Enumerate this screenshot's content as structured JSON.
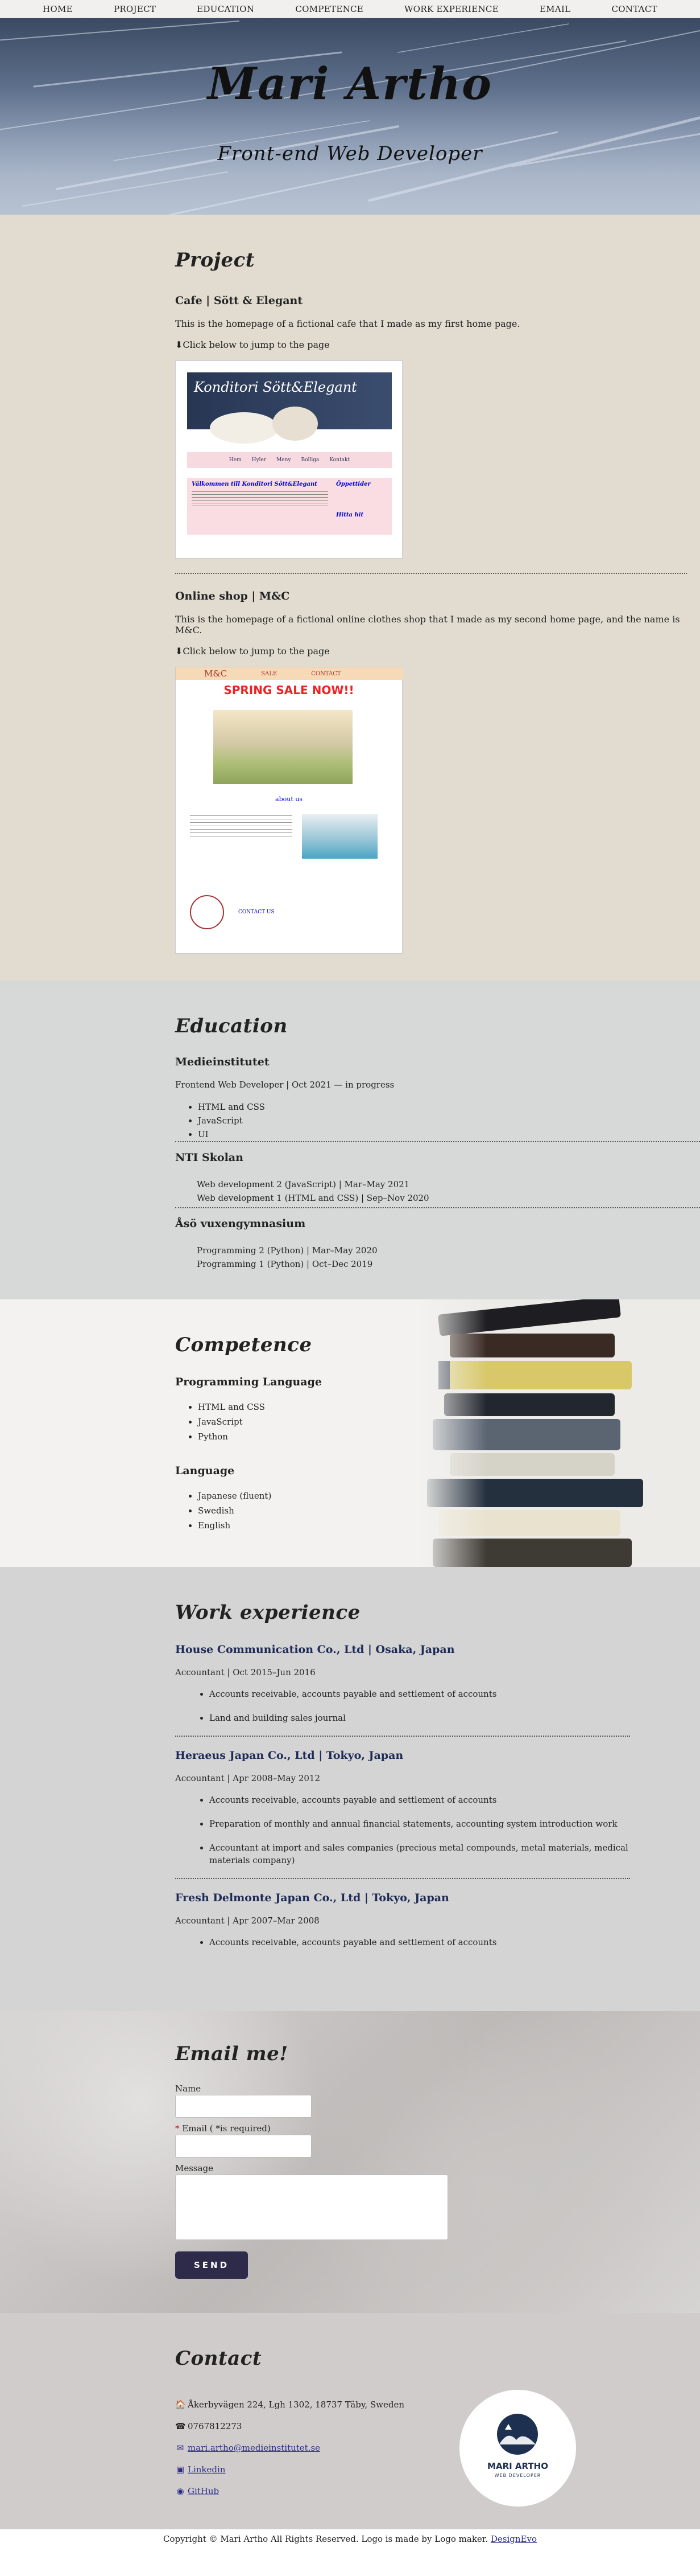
{
  "nav": [
    "HOME",
    "PROJECT",
    "EDUCATION",
    "COMPETENCE",
    "WORK EXPERIENCE",
    "EMAIL",
    "CONTACT"
  ],
  "hero": {
    "title": "Mari Artho",
    "subtitle": "Front-end Web Developer"
  },
  "project": {
    "title": "Project",
    "items": [
      {
        "name": "Cafe | Sött & Elegant",
        "desc": "This is the homepage of a fictional cafe that I made as my first home page.",
        "jump": "⬇Click below to jump to the page",
        "thumb": {
          "banner": "Konditori Sött&Elegant",
          "menu": [
            "Hem",
            "Hyler",
            "Meny",
            "Bolliga",
            "Kontakt"
          ],
          "welcome": "Välkommen till Konditori Sött&Elegant",
          "hours": "Öppettider",
          "find": "Hitta hit"
        }
      },
      {
        "name": "Online shop | M&C",
        "desc": "This is the homepage of a fictional online clothes shop that I made as my second home page, and the name is M&C.",
        "jump": "⬇Click below to jump to the page",
        "thumb": {
          "brand": "M&C",
          "links": [
            "SALE",
            "CONTACT"
          ],
          "sale": "SPRING SALE NOW!!",
          "about": "about us",
          "contact": "CONTACT US"
        }
      }
    ]
  },
  "education": {
    "title": "Education",
    "schools": [
      {
        "name": "Medieinstitutet",
        "line": "Frontend Web Developer | Oct 2021 — in progress",
        "items": [
          "HTML and CSS",
          "JavaScript",
          "UI"
        ]
      },
      {
        "name": "NTI Skolan",
        "items": [
          "Web development 2 (JavaScript) | Mar–May 2021",
          "Web development 1 (HTML and CSS) | Sep–Nov 2020"
        ]
      },
      {
        "name": "Åsö vuxengymnasium",
        "items": [
          "Programming 2 (Python) | Mar–May 2020",
          "Programming 1 (Python) | Oct–Dec 2019"
        ]
      }
    ]
  },
  "competence": {
    "title": "Competence",
    "groups": [
      {
        "name": "Programming Language",
        "items": [
          "HTML and CSS",
          "JavaScript",
          "Python"
        ]
      },
      {
        "name": "Language",
        "items": [
          "Japanese (fluent)",
          "Swedish",
          "English"
        ]
      }
    ]
  },
  "work": {
    "title": "Work experience",
    "jobs": [
      {
        "company": "House Communication Co., Ltd | Osaka, Japan",
        "role": "Accountant | Oct 2015–Jun 2016",
        "tasks": [
          "Accounts receivable, accounts payable and settlement of accounts",
          "Land and building sales journal"
        ]
      },
      {
        "company": "Heraeus Japan Co., Ltd | Tokyo, Japan",
        "role": "Accountant | Apr 2008–May 2012",
        "tasks": [
          "Accounts receivable, accounts payable and settlement of accounts",
          "Preparation of monthly and annual financial statements, accounting system introduction work",
          "Accountant at import and sales companies (precious metal compounds, metal materials, medical materials company)"
        ]
      },
      {
        "company": "Fresh Delmonte Japan Co., Ltd | Tokyo, Japan",
        "role": "Accountant | Apr 2007–Mar 2008",
        "tasks": [
          "Accounts receivable, accounts payable and settlement of accounts"
        ]
      }
    ]
  },
  "email": {
    "title": "Email me!",
    "name_label": "Name",
    "required_mark": "*",
    "email_label": "Email ( *is required)",
    "message_label": "Message",
    "send": "SEND"
  },
  "contact": {
    "title": "Contact",
    "address": "Åkerbyvägen 224, Lgh 1302, 18737 Täby, Sweden",
    "phone": "0767812273",
    "email": "mari.artho@medieinstitutet.se",
    "linkedin": "Linkedin",
    "github": "GitHub",
    "logo_name": "MARI ARTHO",
    "logo_sub": "WEB DEVELOPER"
  },
  "footer": {
    "text": "Copyright © Mari Artho All Rights Reserved. Logo is made by Logo maker.",
    "link": "DesignEvo"
  },
  "colors": {
    "nav_bg": "#f2f0ef",
    "project_bg": "#e1dbd0",
    "education_bg": "#d6d9d8",
    "work_bg": "#d4d4d4",
    "contact_bg": "#d1cccc",
    "link": "#1d2a57",
    "button": "#2e2a4a"
  }
}
